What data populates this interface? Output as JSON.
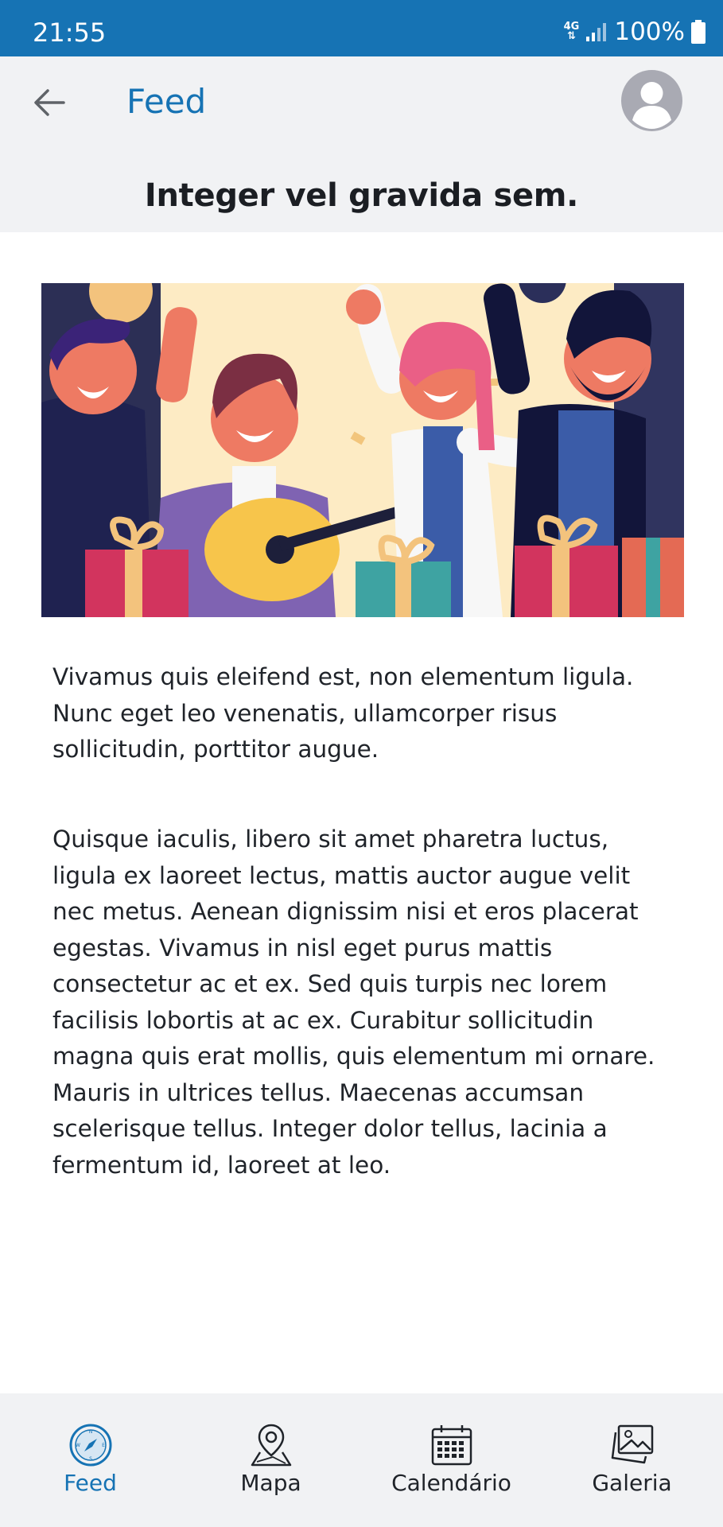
{
  "status_bar": {
    "time": "21:55",
    "network": "4G",
    "battery": "100%"
  },
  "header": {
    "title": "Feed"
  },
  "post": {
    "title": "Integer vel gravida sem.",
    "paragraphs": [
      "Vivamus quis eleifend est, non elementum ligula. Nunc eget leo venenatis, ullamcorper risus sollicitudin, porttitor augue.",
      "Quisque iaculis, libero sit amet pharetra luctus, ligula ex laoreet lectus, mattis auctor augue velit nec metus. Aenean dignissim nisi et eros placerat egestas. Vivamus in nisl eget purus mattis consectetur ac et ex. Sed quis turpis nec lorem facilisis lobortis at ac ex. Curabitur sollicitudin magna quis erat mollis, quis elementum mi ornare. Mauris in ultrices tellus. Maecenas accumsan scelerisque tellus. Integer dolor tellus, lacinia a fermentum id, laoreet at leo."
    ]
  },
  "bottom_nav": [
    {
      "label": "Feed",
      "icon": "compass-icon",
      "active": true
    },
    {
      "label": "Mapa",
      "icon": "map-pin-icon",
      "active": false
    },
    {
      "label": "Calendário",
      "icon": "calendar-icon",
      "active": false
    },
    {
      "label": "Galeria",
      "icon": "gallery-icon",
      "active": false
    }
  ],
  "colors": {
    "primary": "#1673b4",
    "header_bg": "#f1f2f4",
    "text": "#1f2329",
    "avatar": "#a9aab3"
  }
}
